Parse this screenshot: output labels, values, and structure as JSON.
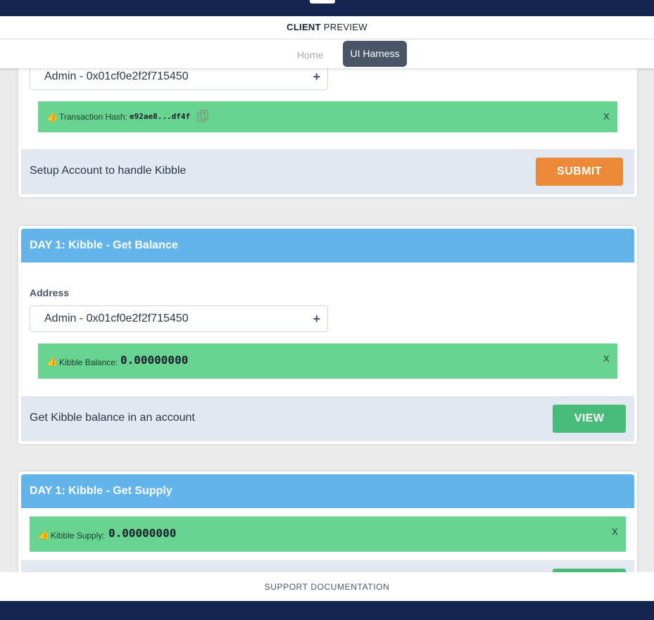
{
  "header": {
    "title_bold": "CLIENT",
    "title_rest": "PREVIEW"
  },
  "nav": {
    "home": "Home",
    "active": "UI Harness"
  },
  "card1": {
    "address_select": "Admin - 0x01cf0e2f2f715450",
    "alert_label": "Transaction Hash:",
    "alert_value": "e92ae8...df4f",
    "close": "X",
    "description": "Setup Account to handle Kibble",
    "button": "SUBMIT"
  },
  "card2": {
    "title": "DAY 1: Kibble - Get Balance",
    "address_label": "Address",
    "address_select": "Admin - 0x01cf0e2f2f715450",
    "alert_label": "Kibble Balance:",
    "alert_value": "0.00000000",
    "close": "X",
    "description": "Get Kibble balance in an account",
    "button": "VIEW"
  },
  "card3": {
    "title": "DAY 1: Kibble - Get Supply",
    "alert_label": "Kibble Supply:",
    "alert_value": "0.00000000",
    "close": "X"
  },
  "support": "SUPPORT DOCUMENTATION",
  "icons": {
    "thumbs_up": "thumbs-up-icon",
    "copy": "copy-icon",
    "plus": "plus-icon"
  },
  "colors": {
    "accent_blue": "#63b3ed",
    "success_green": "#68d391",
    "submit_orange": "#ed8936",
    "view_green": "#48bb78",
    "navy": "#142550"
  }
}
